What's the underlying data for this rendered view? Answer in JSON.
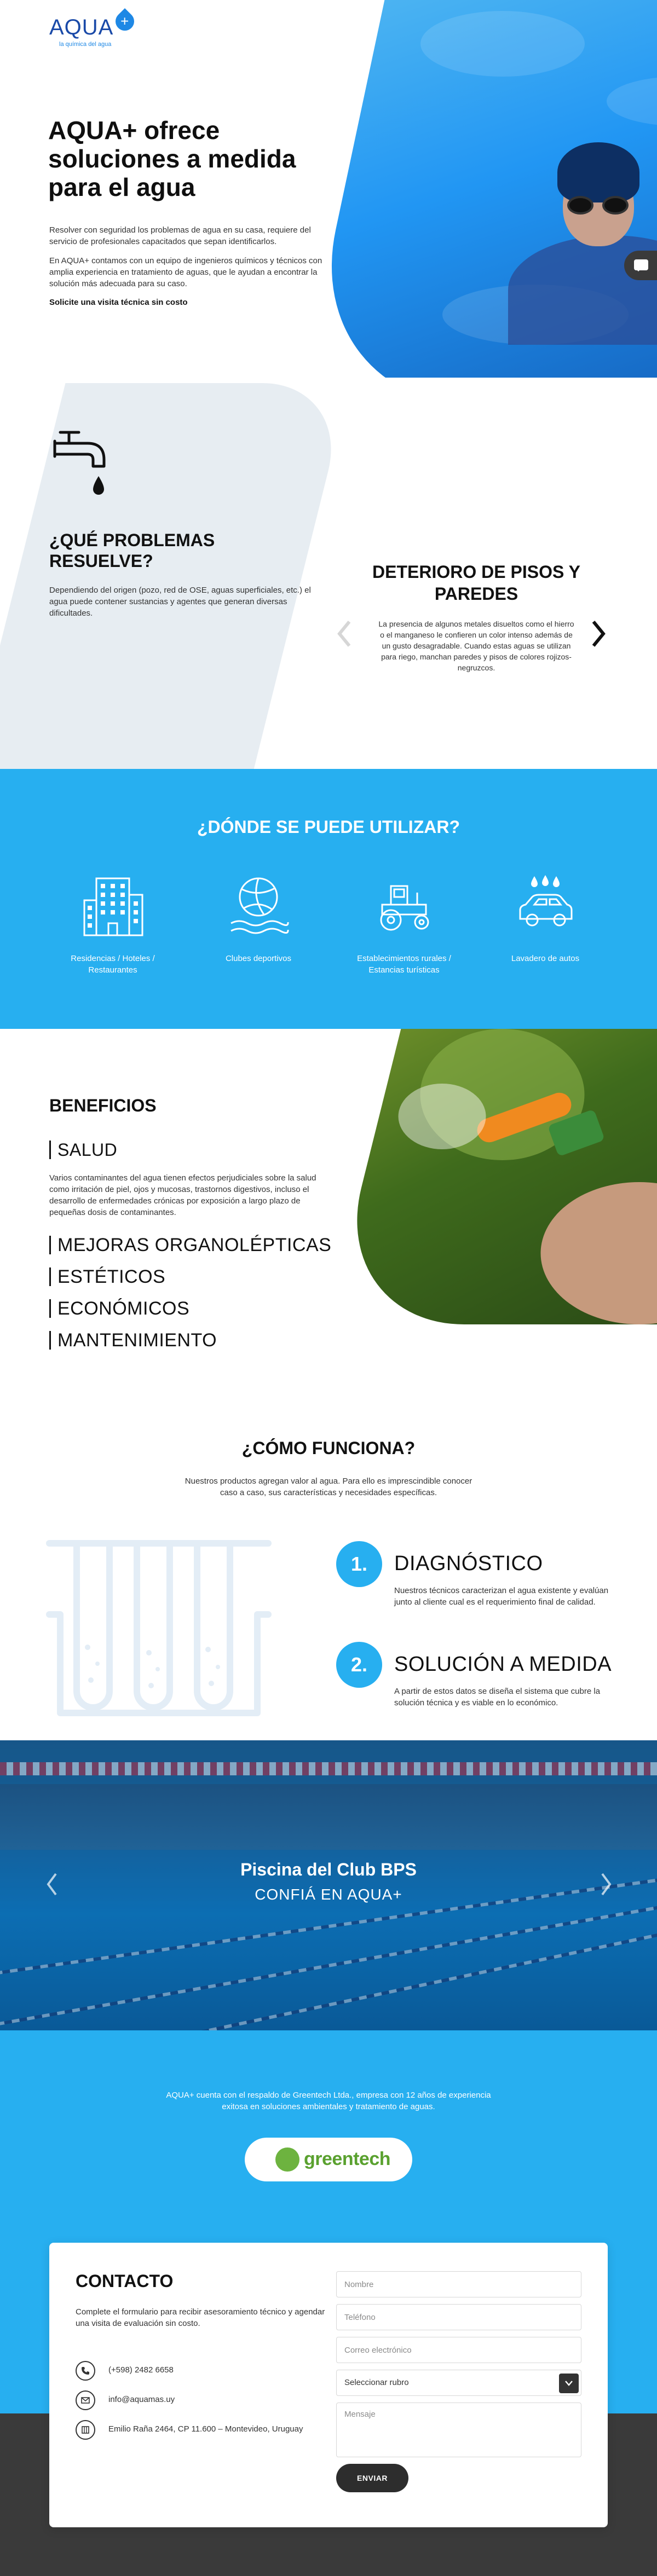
{
  "brand": {
    "name": "AQUA",
    "plus": "+",
    "tagline": "la química del agua",
    "primary_color": "#27aff0",
    "dark_color": "#3a3a3a"
  },
  "hero": {
    "title": "AQUA+ ofrece soluciones a medida para el agua",
    "p1": "Resolver con seguridad los problemas de agua en su casa, requiere del servicio de profesionales capacitados que sepan identificarlos.",
    "p2": "En AQUA+ contamos con un equipo de ingenieros químicos y técnicos con amplia experiencia en tratamiento de aguas, que le ayudan a encontrar la solución más adecuada para su caso.",
    "cta": "Solicite una visita técnica sin costo",
    "chat_icon": "chat-icon"
  },
  "problems": {
    "title": "¿QUÉ PROBLEMAS RESUELVE?",
    "text": "Dependiendo del origen (pozo, red de OSE, aguas superficiales, etc.) el agua puede contener sustancias y agentes que generan diversas dificultades.",
    "slide": {
      "title": "DETERIORO DE PISOS Y PAREDES",
      "text": "La presencia de algunos metales disueltos como el hierro o el manganeso le confieren un color intenso además de un gusto desagradable. Cuando estas aguas se utilizan para riego, manchan paredes y pisos de colores rojizos-negruzcos."
    }
  },
  "where": {
    "title": "¿DÓNDE SE PUEDE UTILIZAR?",
    "items": [
      {
        "label": "Residencias / Hoteles / Restaurantes",
        "icon": "building-icon"
      },
      {
        "label": "Clubes deportivos",
        "icon": "ball-water-icon"
      },
      {
        "label": "Establecimientos rurales / Estancias turísticas",
        "icon": "tractor-icon"
      },
      {
        "label": "Lavadero de autos",
        "icon": "car-wash-icon"
      }
    ]
  },
  "benefits": {
    "title": "BENEFICIOS",
    "items": [
      "SALUD",
      "MEJORAS ORGANOLÉPTICAS",
      "ESTÉTICOS",
      "ECONÓMICOS",
      "MANTENIMIENTO"
    ],
    "salud_text": "Varios contaminantes del agua tienen efectos perjudiciales sobre la salud como irritación de piel, ojos y mucosas, trastornos digestivos, incluso el desarrollo de enfermedades crónicas por exposición a largo plazo de pequeñas dosis de contaminantes."
  },
  "how": {
    "title": "¿CÓMO FUNCIONA?",
    "text": "Nuestros productos agregan valor al agua. Para ello es imprescindible conocer caso a caso, sus características y necesidades específicas.",
    "steps": [
      {
        "num": "1.",
        "title": "DIAGNÓSTICO",
        "text": "Nuestros técnicos caracterizan el agua existente y evalúan junto al cliente cual es el requerimiento final de calidad."
      },
      {
        "num": "2.",
        "title": "SOLUCIÓN A MEDIDA",
        "text": "A partir de estos datos se diseña el sistema que cubre la solución técnica y es viable en lo económico."
      }
    ]
  },
  "pool": {
    "title": "Piscina del Club BPS",
    "subtitle": "CONFIÁ EN AQUA+"
  },
  "greentech": {
    "text": "AQUA+ cuenta con el respaldo de Greentech Ltda., empresa con 12 años de experiencia exitosa en soluciones ambientales y tratamiento de aguas.",
    "logo_text": "greentech"
  },
  "contact": {
    "title": "CONTACTO",
    "text": "Complete el formulario para recibir asesoramiento técnico y agendar una visita de evaluación sin costo.",
    "phone": "(+598) 2482 6658",
    "email": "info@aquamas.uy",
    "address": "Emilio Raña 2464, CP 11.600 – Montevideo, Uruguay",
    "form": {
      "name_placeholder": "Nombre",
      "phone_placeholder": "Teléfono",
      "email_placeholder": "Correo electrónico",
      "select_value": "Seleccionar rubro",
      "message_placeholder": "Mensaje",
      "submit": "ENVIAR"
    }
  }
}
